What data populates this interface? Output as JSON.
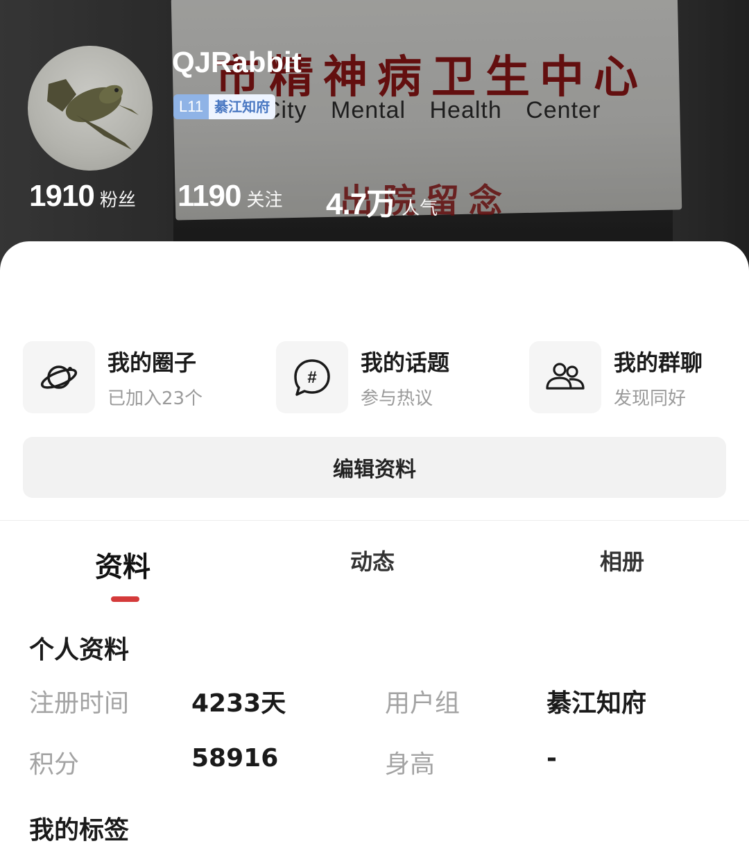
{
  "banner": {
    "paper_title": "市精神病卫生中心",
    "paper_subtitle": "City  Mental  Health  Center",
    "paper_footer": "出院留念"
  },
  "profile": {
    "username": "QJRabbit",
    "level": "L11",
    "title": "綦江知府"
  },
  "stats": [
    {
      "value": "1910",
      "label": "粉丝"
    },
    {
      "value": "1190",
      "label": "关注"
    },
    {
      "value": "4.7万",
      "label": "人气"
    }
  ],
  "entries": [
    {
      "title": "我的圈子",
      "subtitle": "已加入23个",
      "icon": "planet-icon"
    },
    {
      "title": "我的话题",
      "subtitle": "参与热议",
      "icon": "hashtag-bubble-icon"
    },
    {
      "title": "我的群聊",
      "subtitle": "发现同好",
      "icon": "group-people-icon"
    }
  ],
  "edit_button": "编辑资料",
  "tabs": [
    {
      "label": "资料",
      "active": true
    },
    {
      "label": "动态",
      "active": false
    },
    {
      "label": "相册",
      "active": false
    }
  ],
  "info": {
    "section_title": "个人资料",
    "fields": [
      {
        "label": "注册时间",
        "value": "4233天"
      },
      {
        "label": "用户组",
        "value": "綦江知府"
      },
      {
        "label": "积分",
        "value": "58916"
      },
      {
        "label": "身高",
        "value": "-"
      }
    ]
  },
  "next_section_title": "我的标签",
  "colors": {
    "accent": "#d43a3a",
    "level_badge": "#8fb3e6"
  }
}
